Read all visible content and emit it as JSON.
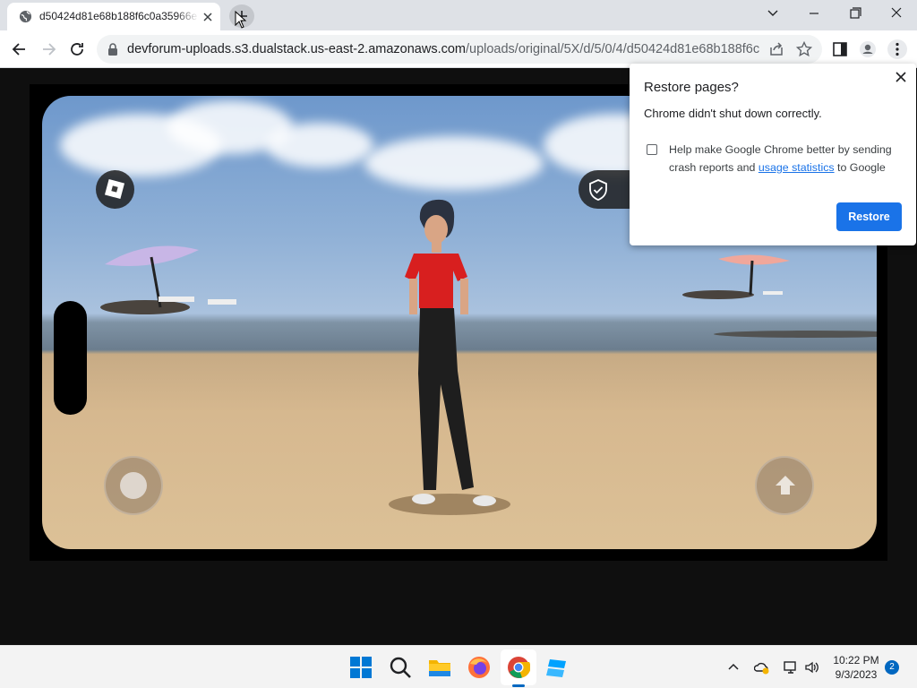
{
  "tab": {
    "title": "d50424d81e68b188f6c0a35966e"
  },
  "omnibox": {
    "host": "devforum-uploads.s3.dualstack.us-east-2.amazonaws.com",
    "path": "/uploads/original/5X/d/5/0/4/d50424d81e68b188f6c0..."
  },
  "dialog": {
    "title": "Restore pages?",
    "subtitle": "Chrome didn't shut down correctly.",
    "checkbox_text_before": "Help make Google Chrome better by sending crash reports and ",
    "checkbox_link": "usage statistics",
    "checkbox_text_after": " to Google",
    "restore_label": "Restore"
  },
  "taskbar": {
    "time": "10:22 PM",
    "date": "9/3/2023",
    "notification_count": "2"
  },
  "colors": {
    "accent": "#1a73e8",
    "taskbar_accent": "#0067c0"
  }
}
